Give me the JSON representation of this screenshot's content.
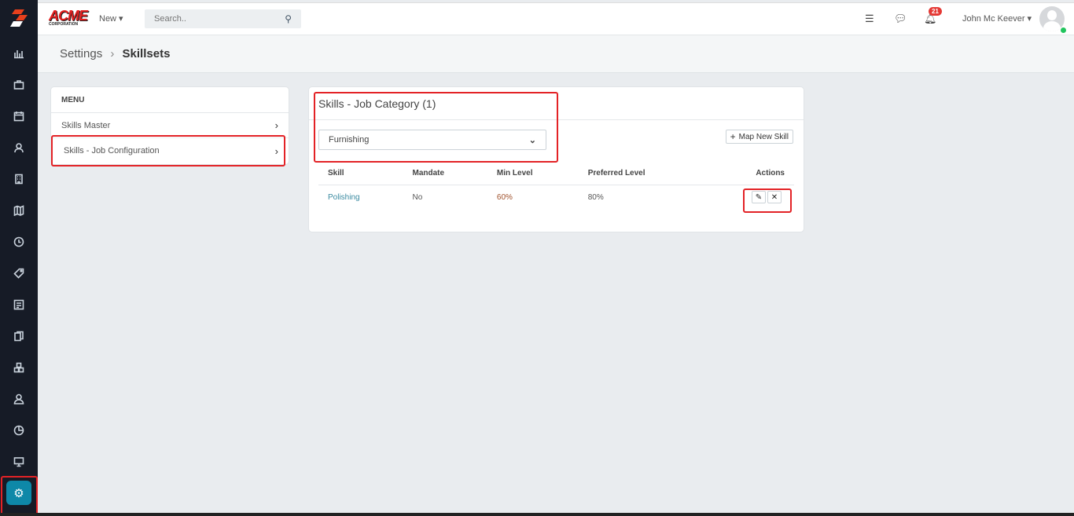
{
  "brand": {
    "name": "ACME",
    "sub": "CORPORATION"
  },
  "topbar": {
    "new_label": "New ▾",
    "search_placeholder": "Search..",
    "notification_count": "21",
    "user_name": "John Mc Keever ▾"
  },
  "breadcrumb": {
    "parent": "Settings",
    "separator": "›",
    "current": "Skillsets"
  },
  "menu": {
    "heading": "MENU",
    "items": [
      {
        "label": "Skills Master"
      },
      {
        "label": "Skills - Job Configuration"
      }
    ]
  },
  "panel": {
    "title": "Skills - Job Category (1)",
    "category": "Furnishing",
    "map_button": "Map New Skill",
    "columns": [
      "Skill",
      "Mandate",
      "Min Level",
      "Preferred Level",
      "Actions"
    ],
    "rows": [
      {
        "skill": "Polishing",
        "mandate": "No",
        "min": "60%",
        "preferred": "80%"
      }
    ]
  },
  "colors": {
    "accent": "#0e88a8",
    "sidebar": "#161b26",
    "highlight": "#e32226"
  }
}
